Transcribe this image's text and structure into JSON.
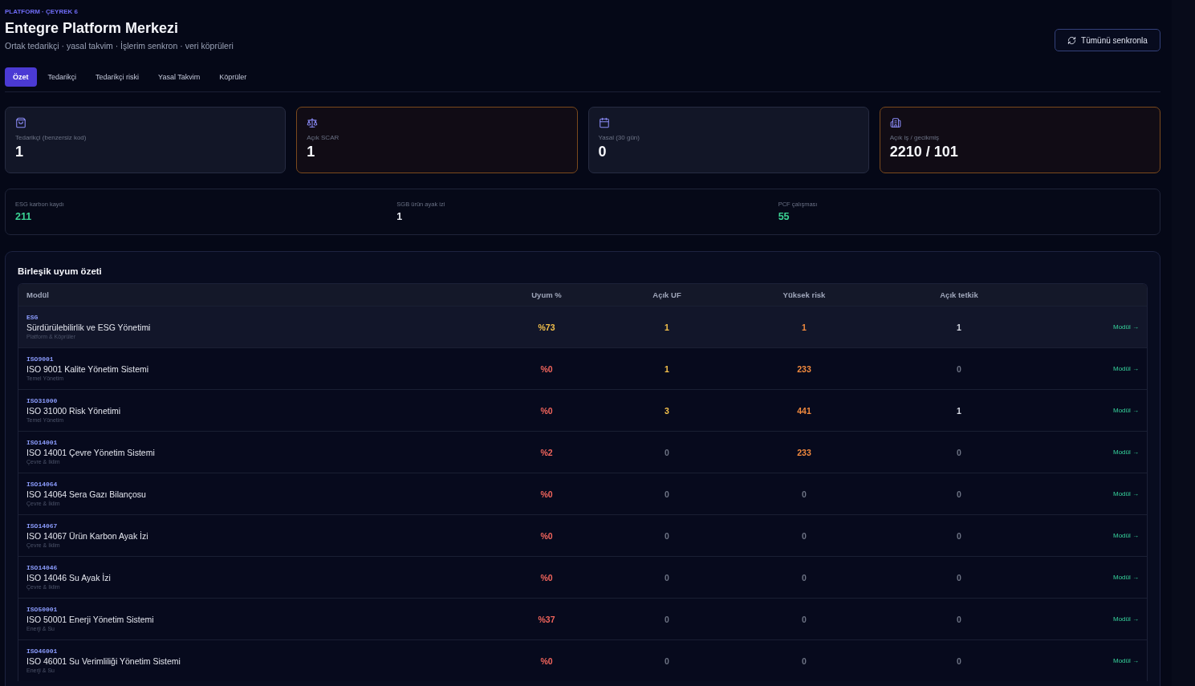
{
  "header": {
    "eyebrow": "PLATFORM · ÇEYREK 6",
    "title": "Entegre Platform Merkezi",
    "subtitle": "Ortak tedarikçi · yasal takvim · İşlerim senkron · veri köprüleri",
    "sync_button": "Tümünü senkronla"
  },
  "tabs": [
    {
      "label": "Özet",
      "selected": true
    },
    {
      "label": "Tedarikçi",
      "selected": false
    },
    {
      "label": "Tedarikçi riski",
      "selected": false
    },
    {
      "label": "Yasal Takvim",
      "selected": false
    },
    {
      "label": "Köprüler",
      "selected": false
    }
  ],
  "kpi_cards": [
    {
      "label": "Tedarikçi (benzersiz kod)",
      "value": "1",
      "alert": false
    },
    {
      "label": "Açık SCAR",
      "value": "1",
      "alert": true
    },
    {
      "label": "Yasal (30 gün)",
      "value": "0",
      "alert": false
    },
    {
      "label": "Açık iş / gecikmiş",
      "value": "2210 / 101",
      "alert": true
    }
  ],
  "stats": [
    {
      "label": "ESG karbon kaydı",
      "value": "211",
      "color": "#3bd394"
    },
    {
      "label": "SGB ürün ayak izi",
      "value": "1",
      "color": "#e9ebf2"
    },
    {
      "label": "PCF çalışması",
      "value": "55",
      "color": "#3bd394"
    }
  ],
  "compliance": {
    "title": "Birleşik uyum özeti",
    "columns": [
      "Modül",
      "Uyum %",
      "Açık UF",
      "Yüksek risk",
      "Açık tetkik"
    ],
    "rows": [
      {
        "highlighted": true,
        "cells": [
          {
            "kind": "module",
            "code": "ESG",
            "name": "Sürdürülebilirlik ve ESG Yönetimi",
            "category": "Platform & Köprüler"
          },
          {
            "kind": "value",
            "text": "%73",
            "color": "#f3c04b"
          },
          {
            "kind": "value",
            "text": "1",
            "color": "#f3c04b"
          },
          {
            "kind": "value",
            "text": "1",
            "color": "#f28a3e"
          },
          {
            "kind": "value",
            "text": "1",
            "color": "#d7dae4"
          },
          {
            "kind": "link",
            "text": "Modül →"
          }
        ]
      },
      {
        "highlighted": false,
        "cells": [
          {
            "kind": "module",
            "code": "ISO9001",
            "name": "ISO 9001 Kalite Yönetim Sistemi",
            "category": "Temel Yönetim"
          },
          {
            "kind": "value",
            "text": "%0",
            "color": "#f2655c"
          },
          {
            "kind": "value",
            "text": "1",
            "color": "#f3c04b"
          },
          {
            "kind": "value",
            "text": "233",
            "color": "#f28a3e"
          },
          {
            "kind": "value",
            "text": "0",
            "color": "#6d7384"
          },
          {
            "kind": "link",
            "text": "Modül →"
          }
        ]
      },
      {
        "highlighted": false,
        "cells": [
          {
            "kind": "module",
            "code": "ISO31000",
            "name": "ISO 31000 Risk Yönetimi",
            "category": "Temel Yönetim"
          },
          {
            "kind": "value",
            "text": "%0",
            "color": "#f2655c"
          },
          {
            "kind": "value",
            "text": "3",
            "color": "#f3c04b"
          },
          {
            "kind": "value",
            "text": "441",
            "color": "#f28a3e"
          },
          {
            "kind": "value",
            "text": "1",
            "color": "#d7dae4"
          },
          {
            "kind": "link",
            "text": "Modül →"
          }
        ]
      },
      {
        "highlighted": false,
        "cells": [
          {
            "kind": "module",
            "code": "ISO14001",
            "name": "ISO 14001 Çevre Yönetim Sistemi",
            "category": "Çevre & İklim"
          },
          {
            "kind": "value",
            "text": "%2",
            "color": "#f2655c"
          },
          {
            "kind": "value",
            "text": "0",
            "color": "#6d7384"
          },
          {
            "kind": "value",
            "text": "233",
            "color": "#f28a3e"
          },
          {
            "kind": "value",
            "text": "0",
            "color": "#6d7384"
          },
          {
            "kind": "link",
            "text": "Modül →"
          }
        ]
      },
      {
        "highlighted": false,
        "cells": [
          {
            "kind": "module",
            "code": "ISO14064",
            "name": "ISO 14064 Sera Gazı Bilançosu",
            "category": "Çevre & İklim"
          },
          {
            "kind": "value",
            "text": "%0",
            "color": "#f2655c"
          },
          {
            "kind": "value",
            "text": "0",
            "color": "#6d7384"
          },
          {
            "kind": "value",
            "text": "0",
            "color": "#6d7384"
          },
          {
            "kind": "value",
            "text": "0",
            "color": "#6d7384"
          },
          {
            "kind": "link",
            "text": "Modül →"
          }
        ]
      },
      {
        "highlighted": false,
        "cells": [
          {
            "kind": "module",
            "code": "ISO14067",
            "name": "ISO 14067 Ürün Karbon Ayak İzi",
            "category": "Çevre & İklim"
          },
          {
            "kind": "value",
            "text": "%0",
            "color": "#f2655c"
          },
          {
            "kind": "value",
            "text": "0",
            "color": "#6d7384"
          },
          {
            "kind": "value",
            "text": "0",
            "color": "#6d7384"
          },
          {
            "kind": "value",
            "text": "0",
            "color": "#6d7384"
          },
          {
            "kind": "link",
            "text": "Modül →"
          }
        ]
      },
      {
        "highlighted": false,
        "cells": [
          {
            "kind": "module",
            "code": "ISO14046",
            "name": "ISO 14046 Su Ayak İzi",
            "category": "Çevre & İklim"
          },
          {
            "kind": "value",
            "text": "%0",
            "color": "#f2655c"
          },
          {
            "kind": "value",
            "text": "0",
            "color": "#6d7384"
          },
          {
            "kind": "value",
            "text": "0",
            "color": "#6d7384"
          },
          {
            "kind": "value",
            "text": "0",
            "color": "#6d7384"
          },
          {
            "kind": "link",
            "text": "Modül →"
          }
        ]
      },
      {
        "highlighted": false,
        "cells": [
          {
            "kind": "module",
            "code": "ISO50001",
            "name": "ISO 50001 Enerji Yönetim Sistemi",
            "category": "Enerji & Su"
          },
          {
            "kind": "value",
            "text": "%37",
            "color": "#f2655c"
          },
          {
            "kind": "value",
            "text": "0",
            "color": "#6d7384"
          },
          {
            "kind": "value",
            "text": "0",
            "color": "#6d7384"
          },
          {
            "kind": "value",
            "text": "0",
            "color": "#6d7384"
          },
          {
            "kind": "link",
            "text": "Modül →"
          }
        ]
      },
      {
        "highlighted": false,
        "cells": [
          {
            "kind": "module",
            "code": "ISO46001",
            "name": "ISO 46001 Su Verimliliği Yönetim Sistemi",
            "category": "Enerji & Su"
          },
          {
            "kind": "value",
            "text": "%0",
            "color": "#f2655c"
          },
          {
            "kind": "value",
            "text": "0",
            "color": "#6d7384"
          },
          {
            "kind": "value",
            "text": "0",
            "color": "#6d7384"
          },
          {
            "kind": "value",
            "text": "0",
            "color": "#6d7384"
          },
          {
            "kind": "link",
            "text": "Modül →"
          }
        ]
      }
    ]
  }
}
